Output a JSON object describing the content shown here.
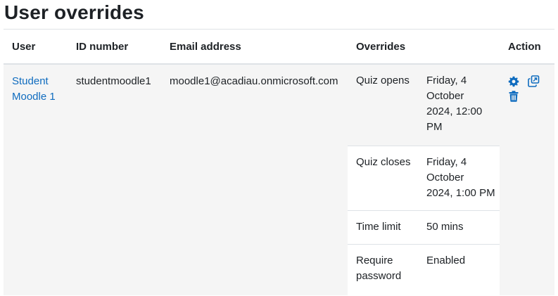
{
  "page": {
    "title": "User overrides"
  },
  "table": {
    "headers": {
      "user": "User",
      "id_number": "ID number",
      "email": "Email address",
      "overrides": "Overrides",
      "action": "Action"
    },
    "rows": [
      {
        "user_line1": "Student",
        "user_line2": "Moodle 1",
        "id_number": "studentmoodle1",
        "email": "moodle1@acadiau.onmicrosoft.com",
        "overrides": [
          {
            "label_lines": [
              "Quiz opens"
            ],
            "value_lines": [
              "Friday, 4",
              "October",
              "2024, 12:00",
              "PM"
            ]
          },
          {
            "label_lines": [
              "Quiz closes"
            ],
            "value_lines": [
              "Friday, 4",
              "October",
              "2024, 1:00 PM"
            ]
          },
          {
            "label_lines": [
              "Time limit"
            ],
            "value_lines": [
              "50 mins"
            ]
          },
          {
            "label_lines": [
              "Require",
              "password"
            ],
            "value_lines": [
              "Enabled"
            ]
          }
        ],
        "actions": {
          "edit_icon": "gear-icon",
          "copy_icon": "copy-icon",
          "delete_icon": "trash-icon"
        }
      }
    ]
  },
  "colors": {
    "link": "#0f6cbf",
    "text": "#1d2125",
    "row_bg": "#f5f5f5",
    "border": "#dee2e6"
  }
}
